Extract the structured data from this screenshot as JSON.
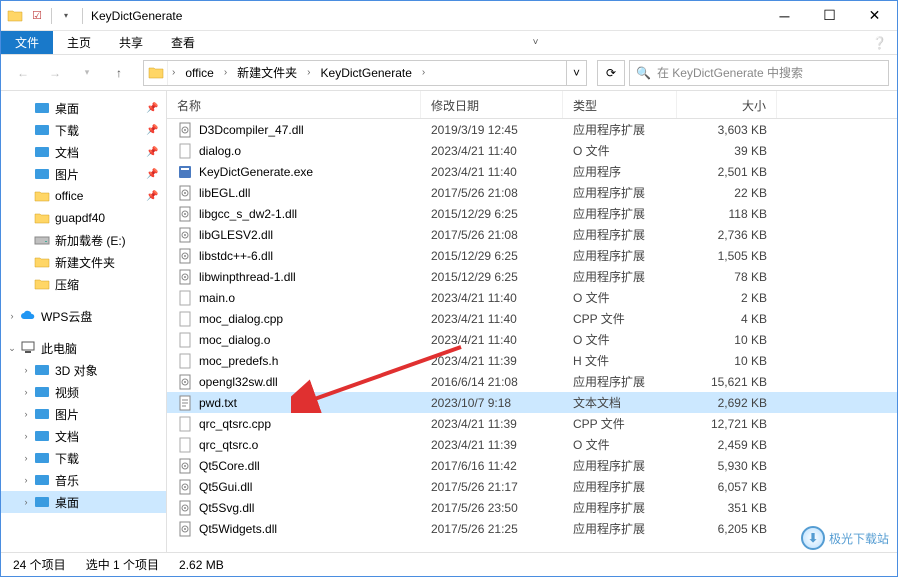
{
  "window": {
    "title": "KeyDictGenerate"
  },
  "ribbon": {
    "file": "文件",
    "home": "主页",
    "share": "共享",
    "view": "查看"
  },
  "breadcrumb": {
    "items": [
      "office",
      "新建文件夹",
      "KeyDictGenerate"
    ]
  },
  "search": {
    "placeholder": "在 KeyDictGenerate 中搜索"
  },
  "columns": {
    "name": "名称",
    "date": "修改日期",
    "type": "类型",
    "size": "大小"
  },
  "sidebar": [
    {
      "icon": "desktop",
      "label": "桌面",
      "pin": true,
      "depth": 1
    },
    {
      "icon": "download",
      "label": "下载",
      "pin": true,
      "depth": 1
    },
    {
      "icon": "document",
      "label": "文档",
      "pin": true,
      "depth": 1
    },
    {
      "icon": "picture",
      "label": "图片",
      "pin": true,
      "depth": 1
    },
    {
      "icon": "folder",
      "label": "office",
      "pin": true,
      "depth": 1
    },
    {
      "icon": "folder",
      "label": "guapdf40",
      "depth": 1
    },
    {
      "icon": "disk",
      "label": "新加载卷 (E:)",
      "depth": 1
    },
    {
      "icon": "folder",
      "label": "新建文件夹",
      "depth": 1
    },
    {
      "icon": "folder",
      "label": "压缩",
      "depth": 1
    },
    {
      "spacer": true
    },
    {
      "icon": "cloud",
      "label": "WPS云盘",
      "depth": 0,
      "exp": ">"
    },
    {
      "spacer": true
    },
    {
      "icon": "pc",
      "label": "此电脑",
      "depth": 0,
      "exp": "v"
    },
    {
      "icon": "3d",
      "label": "3D 对象",
      "depth": 1,
      "exp": ">"
    },
    {
      "icon": "video",
      "label": "视频",
      "depth": 1,
      "exp": ">"
    },
    {
      "icon": "picture",
      "label": "图片",
      "depth": 1,
      "exp": ">"
    },
    {
      "icon": "document",
      "label": "文档",
      "depth": 1,
      "exp": ">"
    },
    {
      "icon": "download",
      "label": "下载",
      "depth": 1,
      "exp": ">"
    },
    {
      "icon": "music",
      "label": "音乐",
      "depth": 1,
      "exp": ">"
    },
    {
      "icon": "desktop",
      "label": "桌面",
      "depth": 1,
      "exp": ">",
      "active": true
    }
  ],
  "files": [
    {
      "icon": "dll",
      "name": "D3Dcompiler_47.dll",
      "date": "2019/3/19 12:45",
      "type": "应用程序扩展",
      "size": "3,603 KB"
    },
    {
      "icon": "o",
      "name": "dialog.o",
      "date": "2023/4/21 11:40",
      "type": "O 文件",
      "size": "39 KB"
    },
    {
      "icon": "exe",
      "name": "KeyDictGenerate.exe",
      "date": "2023/4/21 11:40",
      "type": "应用程序",
      "size": "2,501 KB"
    },
    {
      "icon": "dll",
      "name": "libEGL.dll",
      "date": "2017/5/26 21:08",
      "type": "应用程序扩展",
      "size": "22 KB"
    },
    {
      "icon": "dll",
      "name": "libgcc_s_dw2-1.dll",
      "date": "2015/12/29 6:25",
      "type": "应用程序扩展",
      "size": "118 KB"
    },
    {
      "icon": "dll",
      "name": "libGLESV2.dll",
      "date": "2017/5/26 21:08",
      "type": "应用程序扩展",
      "size": "2,736 KB"
    },
    {
      "icon": "dll",
      "name": "libstdc++-6.dll",
      "date": "2015/12/29 6:25",
      "type": "应用程序扩展",
      "size": "1,505 KB"
    },
    {
      "icon": "dll",
      "name": "libwinpthread-1.dll",
      "date": "2015/12/29 6:25",
      "type": "应用程序扩展",
      "size": "78 KB"
    },
    {
      "icon": "o",
      "name": "main.o",
      "date": "2023/4/21 11:40",
      "type": "O 文件",
      "size": "2 KB"
    },
    {
      "icon": "cpp",
      "name": "moc_dialog.cpp",
      "date": "2023/4/21 11:40",
      "type": "CPP 文件",
      "size": "4 KB"
    },
    {
      "icon": "o",
      "name": "moc_dialog.o",
      "date": "2023/4/21 11:40",
      "type": "O 文件",
      "size": "10 KB"
    },
    {
      "icon": "h",
      "name": "moc_predefs.h",
      "date": "2023/4/21 11:39",
      "type": "H 文件",
      "size": "10 KB"
    },
    {
      "icon": "dll",
      "name": "opengl32sw.dll",
      "date": "2016/6/14 21:08",
      "type": "应用程序扩展",
      "size": "15,621 KB"
    },
    {
      "icon": "txt",
      "name": "pwd.txt",
      "date": "2023/10/7 9:18",
      "type": "文本文档",
      "size": "2,692 KB",
      "selected": true
    },
    {
      "icon": "cpp",
      "name": "qrc_qtsrc.cpp",
      "date": "2023/4/21 11:39",
      "type": "CPP 文件",
      "size": "12,721 KB"
    },
    {
      "icon": "o",
      "name": "qrc_qtsrc.o",
      "date": "2023/4/21 11:39",
      "type": "O 文件",
      "size": "2,459 KB"
    },
    {
      "icon": "dll",
      "name": "Qt5Core.dll",
      "date": "2017/6/16 11:42",
      "type": "应用程序扩展",
      "size": "5,930 KB"
    },
    {
      "icon": "dll",
      "name": "Qt5Gui.dll",
      "date": "2017/5/26 21:17",
      "type": "应用程序扩展",
      "size": "6,057 KB"
    },
    {
      "icon": "dll",
      "name": "Qt5Svg.dll",
      "date": "2017/5/26 23:50",
      "type": "应用程序扩展",
      "size": "351 KB"
    },
    {
      "icon": "dll",
      "name": "Qt5Widgets.dll",
      "date": "2017/5/26 21:25",
      "type": "应用程序扩展",
      "size": "6,205 KB"
    }
  ],
  "status": {
    "items": "24 个项目",
    "selection": "选中 1 个项目",
    "size": "2.62 MB"
  },
  "watermark": "极光下载站"
}
